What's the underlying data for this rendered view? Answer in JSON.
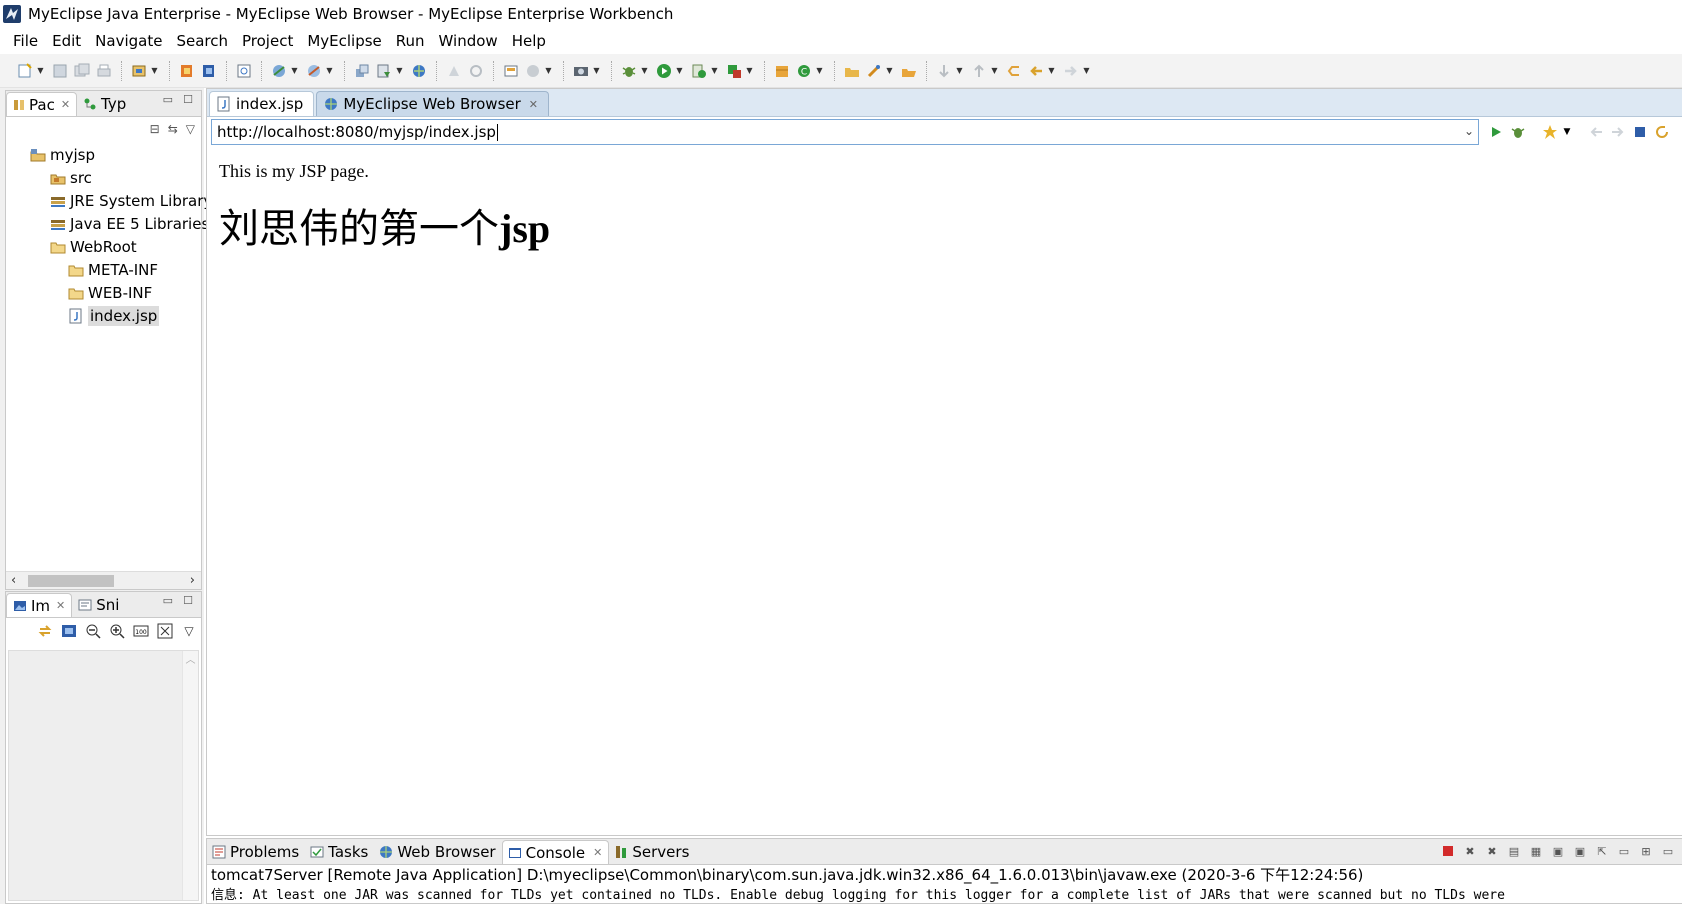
{
  "window": {
    "title": "MyEclipse Java Enterprise - MyEclipse Web Browser - MyEclipse Enterprise Workbench"
  },
  "menubar": {
    "items": [
      "File",
      "Edit",
      "Navigate",
      "Search",
      "Project",
      "MyEclipse",
      "Run",
      "Window",
      "Help"
    ]
  },
  "package_explorer": {
    "tabs": [
      {
        "label": "Pac",
        "active": true
      },
      {
        "label": "Typ",
        "active": false
      }
    ],
    "tree": [
      {
        "label": "myjsp",
        "depth": 0,
        "icon": "project-icon"
      },
      {
        "label": "src",
        "depth": 1,
        "icon": "source-folder-icon"
      },
      {
        "label": "JRE System Library",
        "depth": 1,
        "icon": "library-icon"
      },
      {
        "label": "Java EE 5 Libraries",
        "depth": 1,
        "icon": "library-icon"
      },
      {
        "label": "WebRoot",
        "depth": 1,
        "icon": "folder-icon"
      },
      {
        "label": "META-INF",
        "depth": 2,
        "icon": "folder-icon"
      },
      {
        "label": "WEB-INF",
        "depth": 2,
        "icon": "folder-icon"
      },
      {
        "label": "index.jsp",
        "depth": 2,
        "icon": "jsp-file-icon",
        "selected": true
      }
    ]
  },
  "image_pane": {
    "tabs": [
      {
        "label": "Im",
        "active": true
      },
      {
        "label": "Sni",
        "active": false
      }
    ]
  },
  "editor": {
    "tabs": [
      {
        "label": "index.jsp",
        "active": false
      },
      {
        "label": "MyEclipse Web Browser",
        "active": true
      }
    ],
    "url": "http://localhost:8080/myjsp/index.jsp",
    "page": {
      "line1": "This is my JSP page.",
      "heading_cn": "刘思伟的第一个",
      "heading_en": "jsp"
    }
  },
  "console": {
    "tabs": [
      {
        "label": "Problems",
        "active": false
      },
      {
        "label": "Tasks",
        "active": false
      },
      {
        "label": "Web Browser",
        "active": false
      },
      {
        "label": "Console",
        "active": true
      },
      {
        "label": "Servers",
        "active": false
      }
    ],
    "line1": "tomcat7Server [Remote Java Application] D:\\myeclipse\\Common\\binary\\com.sun.java.jdk.win32.x86_64_1.6.0.013\\bin\\javaw.exe (2020-3-6 下午12:24:56)",
    "line2": "信息: At least one JAR was scanned for TLDs yet contained no TLDs. Enable debug logging for this logger for a complete list of JARs that were scanned but no TLDs were"
  },
  "colors": {
    "tab_active_bg": "#c9d9ea",
    "url_border": "#7aa7d6",
    "toolbar_bg": "#f3f3f3"
  }
}
